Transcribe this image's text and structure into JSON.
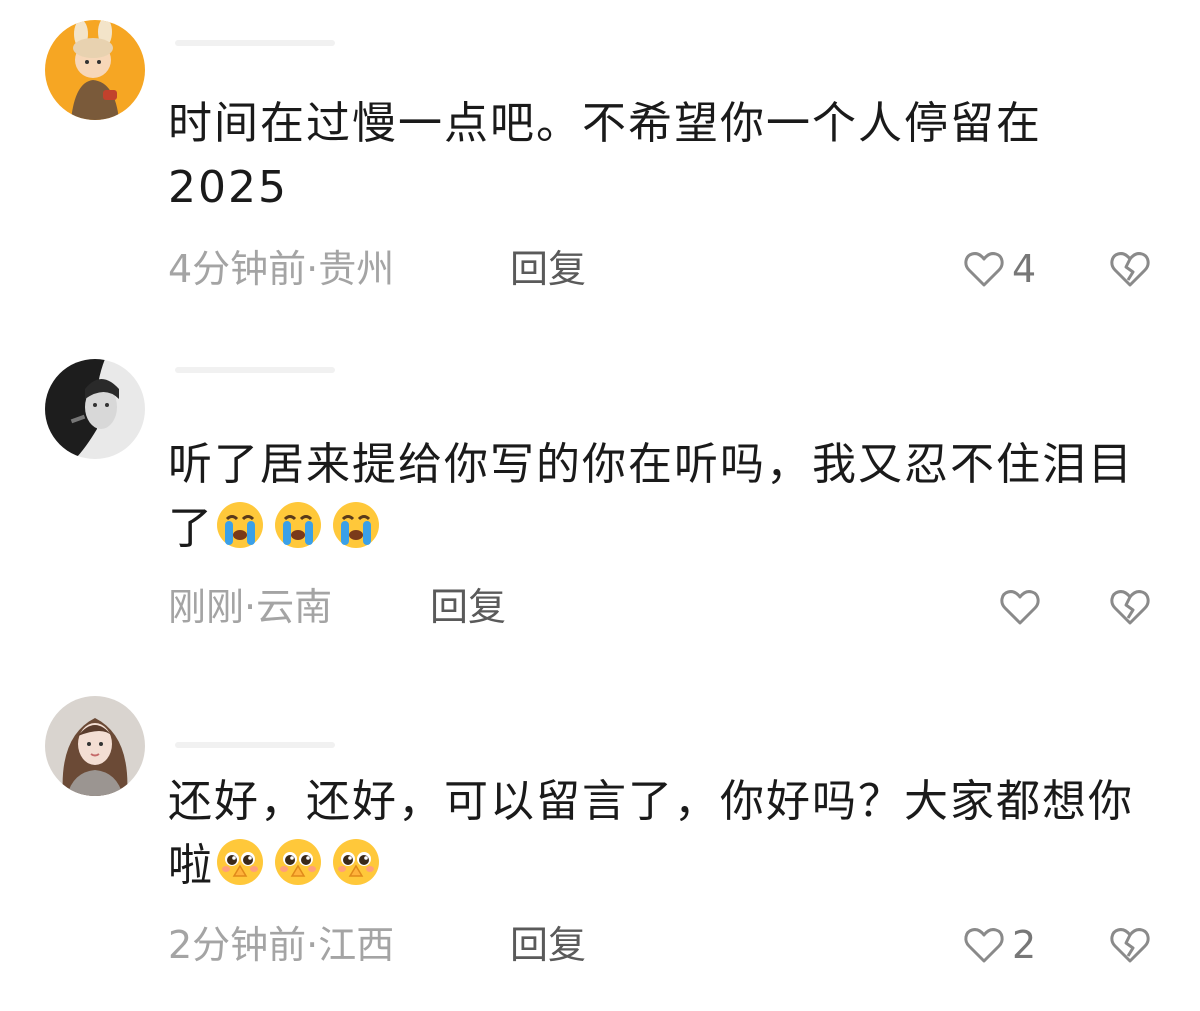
{
  "comments": [
    {
      "avatar": "baby-bunny-avatar",
      "text": "时间在过慢一点吧。不希望你一个人停留在2025",
      "emojis": [],
      "meta": "4分钟前·贵州",
      "reply_label": "回复",
      "like_count": "4",
      "icons": {
        "like": "heart-outline-icon",
        "dislike": "broken-heart-icon"
      }
    },
    {
      "avatar": "woman-bw-avatar",
      "text": "听了居来提给你写的你在听吗，我又忍不住泪目了",
      "emojis": [
        "crying-face-emoji",
        "crying-face-emoji",
        "crying-face-emoji"
      ],
      "meta": "刚刚·云南",
      "reply_label": "回复",
      "like_count": "",
      "icons": {
        "like": "heart-outline-icon",
        "dislike": "broken-heart-icon"
      }
    },
    {
      "avatar": "girl-avatar",
      "text": "还好，还好，可以留言了，你好吗？大家都想你啦",
      "emojis": [
        "pleading-face-emoji",
        "pleading-face-emoji",
        "pleading-face-emoji"
      ],
      "meta": "2分钟前·江西",
      "reply_label": "回复",
      "like_count": "2",
      "icons": {
        "like": "heart-outline-icon",
        "dislike": "broken-heart-icon"
      }
    }
  ],
  "colors": {
    "text": "#1a1a1a",
    "meta": "#a4a4a4",
    "reply": "#5a5a5a",
    "icon": "#8a8a8a",
    "emoji_yellow": "#ffc83a"
  }
}
